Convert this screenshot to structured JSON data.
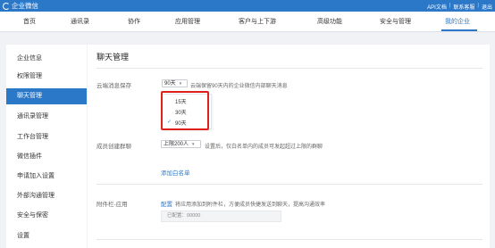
{
  "topbar": {
    "brand": "企业微信",
    "links": [
      "API文档",
      "联系客服",
      "退出"
    ]
  },
  "nav": {
    "items": [
      {
        "label": "首页"
      },
      {
        "label": "通讯录"
      },
      {
        "label": "协作"
      },
      {
        "label": "应用管理"
      },
      {
        "label": "客户与上下游"
      },
      {
        "label": "高级功能"
      },
      {
        "label": "安全与管理"
      },
      {
        "label": "我的企业",
        "active": true
      }
    ]
  },
  "sidebar": {
    "items": [
      {
        "label": "企业信息"
      },
      {
        "label": "权限管理"
      },
      {
        "label": "聊天管理",
        "active": true
      },
      {
        "label": "通讯录管理"
      },
      {
        "label": "工作台管理"
      },
      {
        "label": "微信插件"
      },
      {
        "label": "申请加入设置"
      },
      {
        "label": "外部沟通管理"
      },
      {
        "label": "安全与保密"
      },
      {
        "label": "设置"
      }
    ]
  },
  "main": {
    "title": "聊天管理",
    "cloud": {
      "label": "云端消息保存",
      "selected": "90天",
      "hint": "云端保留90天内的企业微信内部聊天消息",
      "options": [
        {
          "label": "15天",
          "checked": false
        },
        {
          "label": "30天",
          "checked": false
        },
        {
          "label": "90天",
          "checked": true
        }
      ]
    },
    "group": {
      "label": "成员创建群聊",
      "selected": "上限200人",
      "hint": "设置后，仅白名单内的成员可发起超过上限的群聊",
      "whitelist_link": "添加白名单"
    },
    "attachment": {
      "label": "附件栏-应用",
      "config_link": "配置",
      "hint": "将应用添加到附件栏，方便成员快捷发送到聊天，提高沟通效率",
      "configured_label": "已配置：",
      "configured_value": "00000"
    }
  },
  "colors": {
    "brand": "#2c78c8",
    "highlight": "#e0201b"
  }
}
